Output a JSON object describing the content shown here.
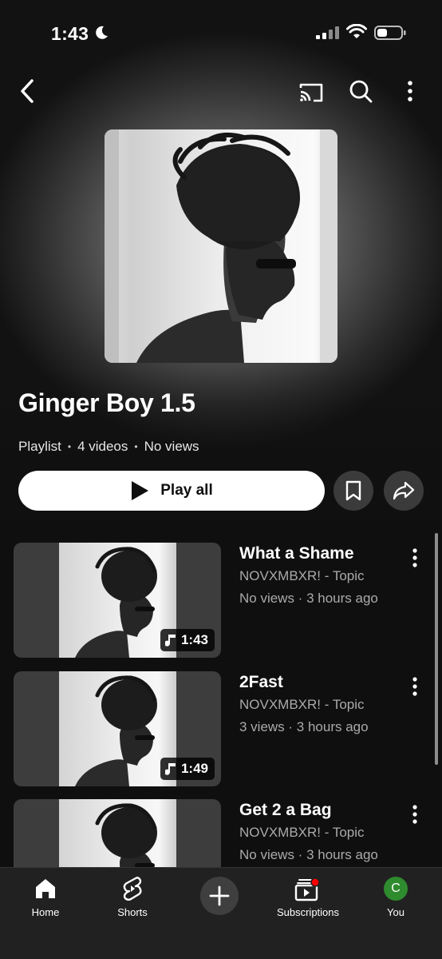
{
  "status_bar": {
    "time": "1:43"
  },
  "playlist": {
    "title": "Ginger Boy 1.5",
    "type": "Playlist",
    "video_count": "4 videos",
    "views": "No views",
    "play_all_label": "Play all"
  },
  "videos": [
    {
      "title": "What a Shame",
      "channel": "NOVXMBXR! - Topic",
      "stats": "No views · 3 hours ago",
      "duration": "1:43"
    },
    {
      "title": "2Fast",
      "channel": "NOVXMBXR! - Topic",
      "stats": "3 views · 3 hours ago",
      "duration": "1:49"
    },
    {
      "title": "Get 2 a Bag",
      "channel": "NOVXMBXR! - Topic",
      "stats": "No views · 3 hours ago",
      "duration": ""
    }
  ],
  "nav": {
    "home": "Home",
    "shorts": "Shorts",
    "subscriptions": "Subscriptions",
    "you": "You",
    "avatar_letter": "C"
  },
  "icons": [
    "back-icon",
    "cast-icon",
    "search-icon",
    "more-vert-icon",
    "play-icon",
    "bookmark-icon",
    "share-icon",
    "music-note-icon",
    "home-icon",
    "shorts-icon",
    "add-icon",
    "subscriptions-icon"
  ],
  "colors": {
    "background": "#0f0f0f",
    "nav_bar": "#212121",
    "avatar": "#2e8b2e",
    "notification_dot": "#ff0000"
  }
}
